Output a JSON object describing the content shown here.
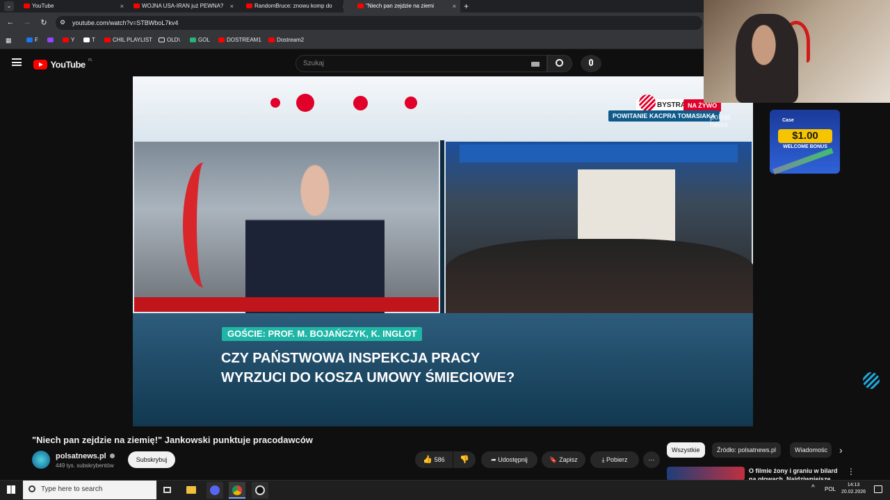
{
  "browser": {
    "tabs": [
      {
        "title": "YouTube"
      },
      {
        "title": "WOJNA USA-IRAN już PEWNA?"
      },
      {
        "title": "RandomBruce: znowu komp do"
      },
      {
        "title": "\"Niech pan zejdzie na ziemi"
      }
    ],
    "new_tab_label": "+",
    "close_label": "×",
    "url": "youtube.com/watch?v=STBWboL7kv4",
    "bookmarks": [
      "F",
      "Y",
      "T",
      "CHIL PLAYLIST",
      "OLD\\",
      "GOL",
      "DOSTREAM1",
      "Dostream2"
    ]
  },
  "youtube": {
    "logo_text": "YouTube",
    "logo_region": "PL",
    "search_placeholder": "Szukaj",
    "video": {
      "brand_text": "BYSTRA",
      "live_text": "NA ŻYWO",
      "welcome_text": "POWITANIE KACPRA TOMASIAKA",
      "channel_logo_line1": "polsat",
      "channel_logo_line2": "news",
      "guests_text": "GOŚCIE: PROF. M. BOJAŃCZYK, K. INGLOT",
      "headline_line1": "CZY PAŃSTWOWA INSPEKCJA PRACY",
      "headline_line2": "WYRZUCI DO KOSZA UMOWY ŚMIECIOWE?"
    },
    "title": "\"Niech pan zejdzie na ziemię!\" Jankowski punktuje pracodawców",
    "channel": {
      "name": "polsatnews.pl",
      "subscribers": "449 tys. subskrybentów"
    },
    "subscribe_label": "Subskrybuj",
    "likes": "586",
    "share_label": "Udostępnij",
    "save_label": "Zapisz",
    "download_label": "Pobierz",
    "chips": [
      "Wszystkie",
      "Źródło: polsatnews.pl",
      "Wiadomośc"
    ],
    "recommendation": {
      "title": "O filmie żony i graniu w bilard na głowach. Najdziwniejsze"
    }
  },
  "overlay_ad": {
    "brand": "Case",
    "amount": "$1.00",
    "bonus": "WELCOME BONUS"
  },
  "taskbar": {
    "search_placeholder": "Type here to search",
    "language": "POL",
    "time": "14:13",
    "date": "20.02.2026"
  },
  "colors": {
    "youtube_red": "#ff0000",
    "polsat_red": "#e0002a",
    "guest_teal": "#1fb6a6"
  }
}
